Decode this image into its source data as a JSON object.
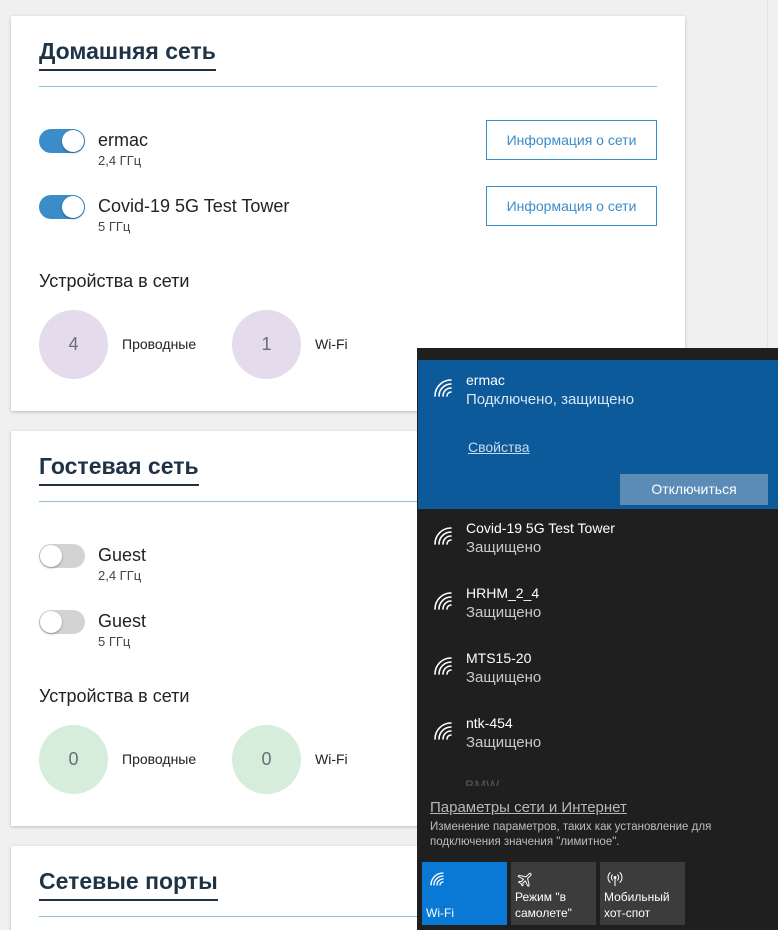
{
  "home": {
    "title": "Домашняя сеть",
    "networks": [
      {
        "ssid": "ermac",
        "band": "2,4 ГГц",
        "enabled": true,
        "info_label": "Информация о сети"
      },
      {
        "ssid": "Covid-19 5G Test Tower",
        "band": "5 ГГц",
        "enabled": true,
        "info_label": "Информация о сети"
      }
    ],
    "devices_heading": "Устройства в сети",
    "wired_count": "4",
    "wired_label": "Проводные",
    "wifi_count": "1",
    "wifi_label": "Wi-Fi"
  },
  "guest": {
    "title": "Гостевая сеть",
    "networks": [
      {
        "ssid": "Guest",
        "band": "2,4 ГГц",
        "enabled": false
      },
      {
        "ssid": "Guest",
        "band": "5 ГГц",
        "enabled": false
      }
    ],
    "devices_heading": "Устройства в сети",
    "wired_count": "0",
    "wired_label": "Проводные",
    "wifi_count": "0",
    "wifi_label": "Wi-Fi"
  },
  "ports": {
    "title": "Сетевые порты"
  },
  "flyout": {
    "connected": {
      "name": "ermac",
      "status": "Подключено, защищено",
      "properties_label": "Свойства",
      "disconnect_label": "Отключиться"
    },
    "networks": [
      {
        "name": "Covid-19 5G Test Tower",
        "status": "Защищено"
      },
      {
        "name": "HRHM_2_4",
        "status": "Защищено"
      },
      {
        "name": "MTS15-20",
        "status": "Защищено"
      },
      {
        "name": "ntk-454",
        "status": "Защищено"
      }
    ],
    "partial_network": "BMW",
    "settings_link": "Параметры сети и Интернет",
    "settings_desc": "Изменение параметров, таких как установление для подключения значения \"лимитное\".",
    "quick_actions": [
      {
        "label": "Wi-Fi",
        "icon": "wifi-icon",
        "active": true
      },
      {
        "label": "Режим \"в самолете\"",
        "icon": "airplane-icon",
        "active": false
      },
      {
        "label": "Мобильный хот-спот",
        "icon": "hotspot-icon",
        "active": false
      }
    ]
  }
}
